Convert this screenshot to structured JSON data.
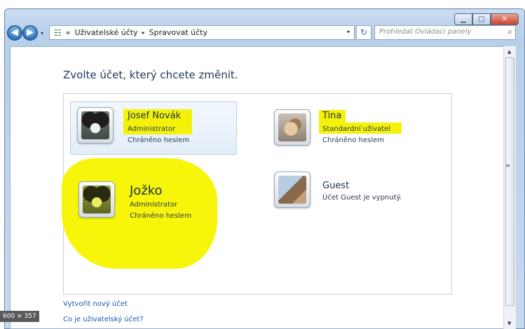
{
  "nav": {
    "back_icon": "back-arrow-icon",
    "forward_icon": "forward-arrow-icon",
    "dropdown_glyph": "▾"
  },
  "address": {
    "overflow": "«",
    "crumb1": "Uživatelské účty",
    "separator": "▸",
    "crumb2": "Spravovat účty"
  },
  "search": {
    "placeholder": "Prohledat Ovládací panely"
  },
  "main": {
    "heading": "Zvolte účet, který chcete změnit."
  },
  "accounts": [
    {
      "name": "Josef Novák",
      "role": "Administrator",
      "status": "Chráněno heslem",
      "icon": "dog-avatar-icon"
    },
    {
      "name": "Tina",
      "role": "Standardní uživatel",
      "status": "Chráněno heslem",
      "icon": "cat-avatar-icon"
    },
    {
      "name": "Jožko",
      "role": "Administrator",
      "status": "Chráněno heslem",
      "icon": "dog-avatar-icon"
    },
    {
      "name": "Guest",
      "role": "Účet Guest je vypnutý.",
      "icon": "guest-avatar-icon"
    }
  ],
  "links": {
    "create": "Vytvořit nový účet",
    "what_is": "Co je uživatelský účet?"
  },
  "badge": "600 × 357",
  "colors": {
    "highlight": "#f4f20b",
    "link": "#1a56b8",
    "heading": "#1e395b"
  }
}
